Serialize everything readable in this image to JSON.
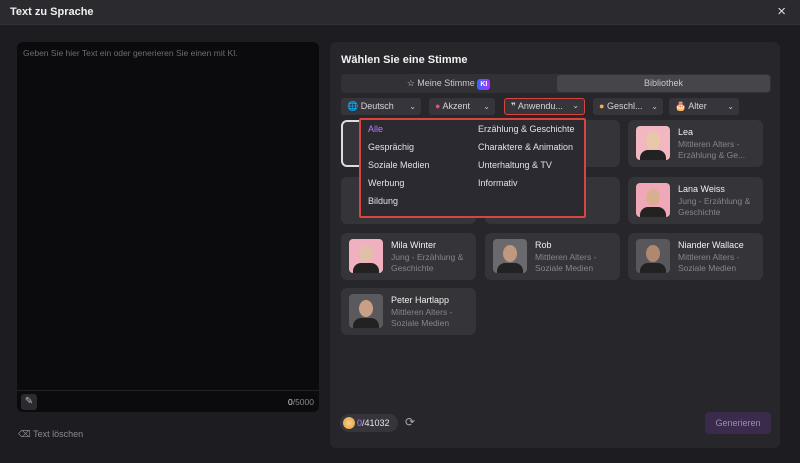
{
  "window": {
    "title": "Text zu Sprache",
    "close_icon": "×"
  },
  "editor": {
    "placeholder": "Geben Sie hier Text ein oder generieren Sie einen mit KI.",
    "count_current": "0",
    "count_max": "/5000",
    "clear_label": "Text löschen"
  },
  "panel": {
    "heading": "Wählen Sie eine Stimme",
    "tabs": [
      {
        "label": "Meine Stimme",
        "badge": "KI"
      },
      {
        "label": "Bibliothek",
        "active": true
      }
    ],
    "filters": [
      {
        "label": "Deutsch",
        "icon": "globe-icon"
      },
      {
        "label": "Akzent",
        "icon": "lips-icon"
      },
      {
        "label": "Anwendu...",
        "icon": "quote-icon",
        "active": true
      },
      {
        "label": "Geschl...",
        "icon": "gender-icon"
      },
      {
        "label": "Alter",
        "icon": "cake-icon"
      }
    ],
    "dropdown": {
      "options": [
        "Alle",
        "Gesprächig",
        "Soziale Medien",
        "Werbung",
        "Bildung",
        "Erzählung & Geschichte",
        "Charaktere & Animation",
        "Unterhaltung & TV",
        "Informativ"
      ],
      "selected": "Alle",
      "selected_color": "#b57cff"
    },
    "voices": [
      {
        "name": "Lea",
        "desc": "Mittleren Alters - Erzählung & Ge..."
      },
      {
        "name": "Lana Weiss",
        "desc": "Jung - Erzählung & Geschichte"
      },
      {
        "name": "Mila Winter",
        "desc": "Jung - Erzählung & Geschichte"
      },
      {
        "name": "Rob",
        "desc": "Mittleren Alters - Soziale Medien"
      },
      {
        "name": "Niander Wallace",
        "desc": "Mittleren Alters - Soziale Medien"
      },
      {
        "name": "Peter Hartlapp",
        "desc": "Mittleren Alters - Soziale Medien"
      }
    ],
    "credits": {
      "used": "0",
      "total": "/41032"
    },
    "generate_label": "Generieren"
  },
  "colors": {
    "accent": "#b57cff",
    "highlight_border": "#d9453d"
  }
}
